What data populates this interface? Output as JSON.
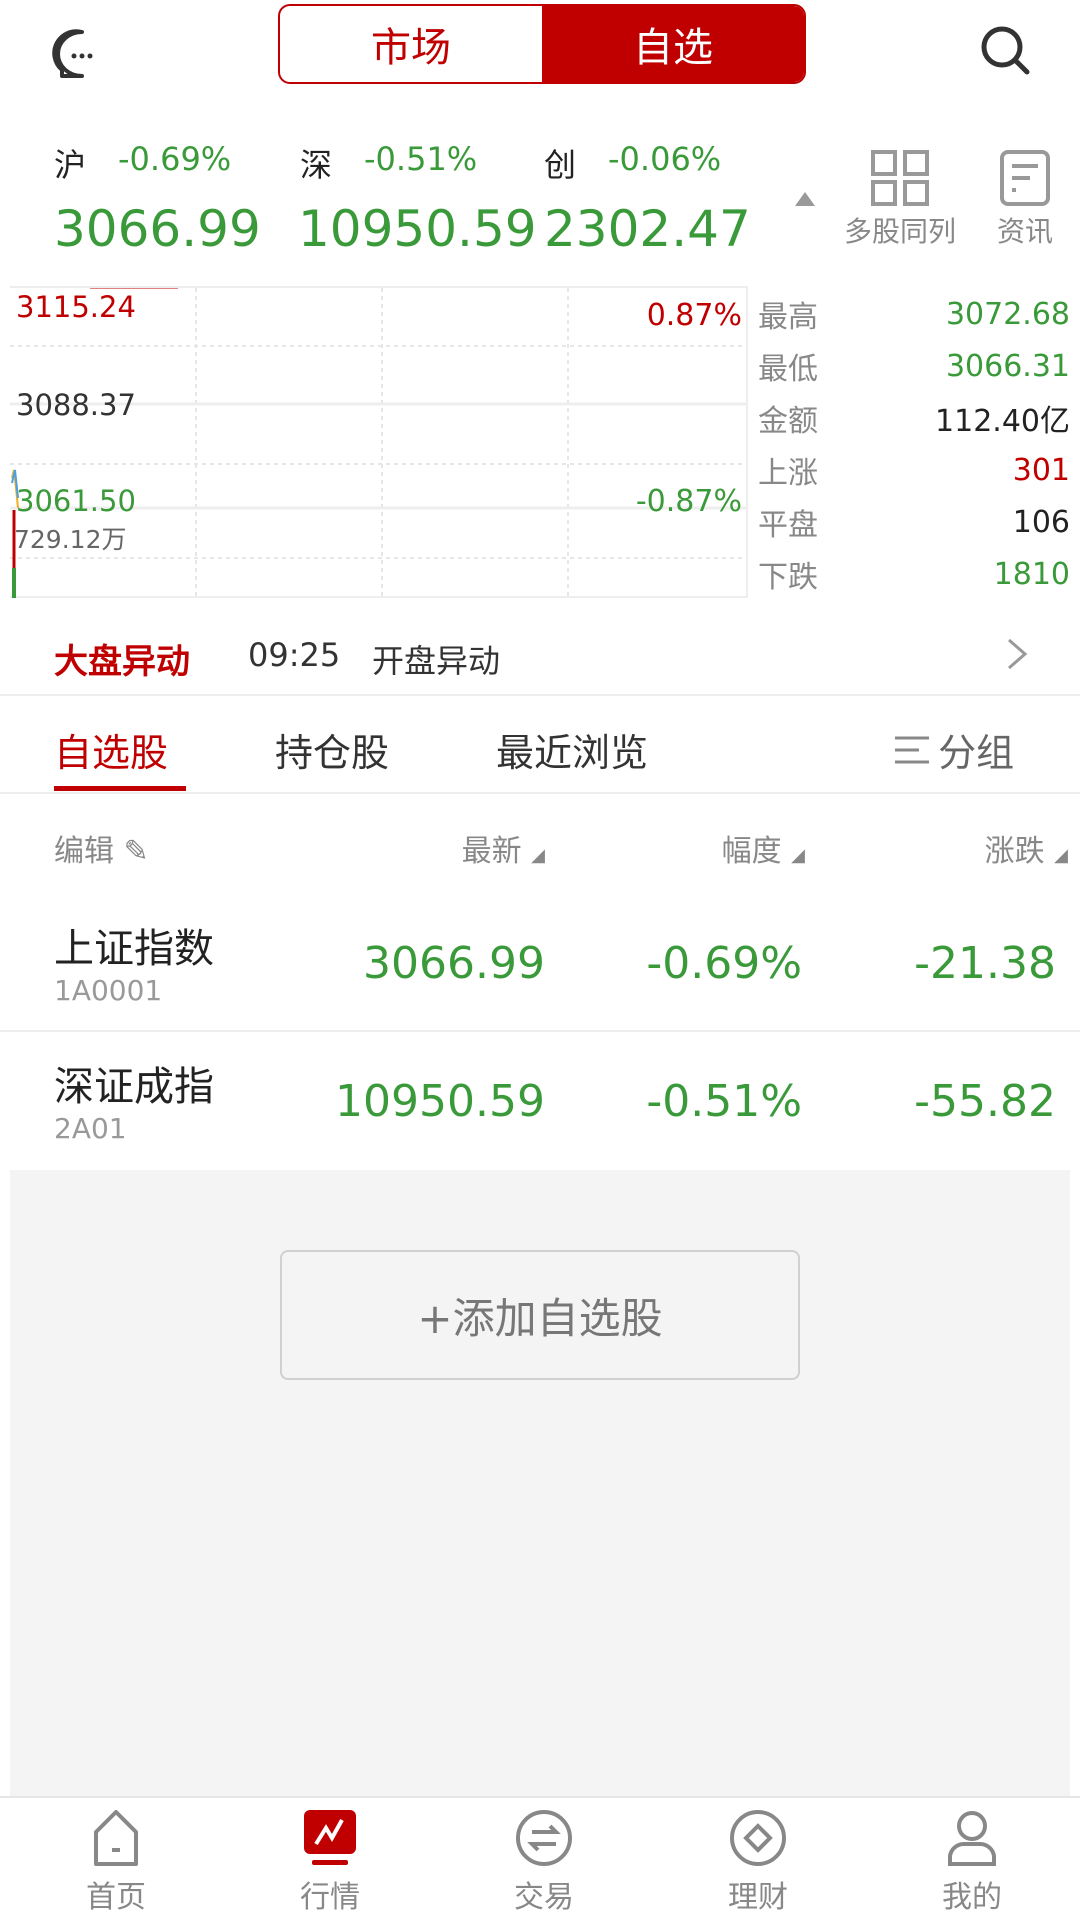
{
  "header": {
    "tabs": [
      {
        "label": "市场",
        "active": false
      },
      {
        "label": "自选",
        "active": true
      }
    ]
  },
  "indices": [
    {
      "label": "沪",
      "pct": "-0.69%",
      "value": "3066.99"
    },
    {
      "label": "深",
      "pct": "-0.51%",
      "value": "10950.59"
    },
    {
      "label": "创",
      "pct": "-0.06%",
      "value": "2302.47"
    }
  ],
  "tools": {
    "multi": "多股同列",
    "news": "资讯"
  },
  "chart": {
    "high": "3115.24",
    "mid": "3088.37",
    "low": "3061.50",
    "high_pct": "0.87%",
    "low_pct": "-0.87%",
    "volume": "729.12万"
  },
  "stats": [
    {
      "k": "最高",
      "v": "3072.68",
      "color": "#3a9a3a"
    },
    {
      "k": "最低",
      "v": "3066.31",
      "color": "#3a9a3a"
    },
    {
      "k": "金额",
      "v": "112.40亿",
      "color": "#222"
    },
    {
      "k": "上涨",
      "v": "301",
      "color": "#c00000"
    },
    {
      "k": "平盘",
      "v": "106",
      "color": "#222"
    },
    {
      "k": "下跌",
      "v": "1810",
      "color": "#3a9a3a"
    }
  ],
  "alert": {
    "title": "大盘异动",
    "time": "09:25",
    "text": "开盘异动"
  },
  "tabs": [
    "自选股",
    "持仓股",
    "最近浏览"
  ],
  "group": "分组",
  "table": {
    "edit": "编辑",
    "cols": [
      "最新",
      "幅度",
      "涨跌"
    ],
    "rows": [
      {
        "name": "上证指数",
        "code": "1A0001",
        "last": "3066.99",
        "pct": "-0.69%",
        "chg": "-21.38"
      },
      {
        "name": "深证成指",
        "code": "2A01",
        "last": "10950.59",
        "pct": "-0.51%",
        "chg": "-55.82"
      }
    ]
  },
  "add_button": "+添加自选股",
  "nav": [
    {
      "label": "首页",
      "icon": "home-icon"
    },
    {
      "label": "行情",
      "icon": "market-icon",
      "active": true
    },
    {
      "label": "交易",
      "icon": "trade-icon"
    },
    {
      "label": "理财",
      "icon": "finance-icon"
    },
    {
      "label": "我的",
      "icon": "user-icon"
    }
  ],
  "colors": {
    "accent": "#c00000",
    "down": "#3a9a3a"
  }
}
